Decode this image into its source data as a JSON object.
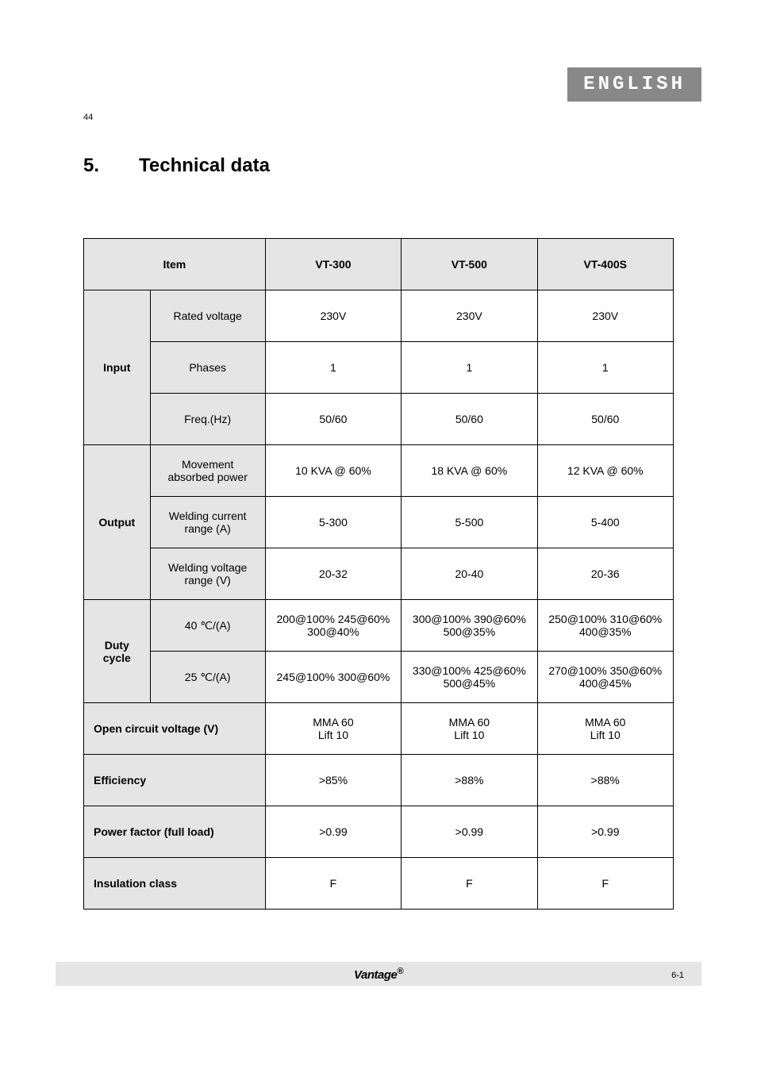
{
  "language_tab": "ENGLISH",
  "page_top": "44",
  "heading": {
    "number": "5.",
    "text": "Technical data"
  },
  "table": {
    "header": [
      "",
      "Item",
      "VT-300",
      "VT-500",
      "VT-400S"
    ],
    "rows": [
      {
        "group": "Input",
        "sub_rows": [
          {
            "sub": "Rated voltage",
            "c1": "230V",
            "c2": "230V",
            "c3": "230V"
          },
          {
            "sub": "Phases",
            "c1": "1",
            "c2": "1",
            "c3": "1"
          },
          {
            "sub": "Freq.(Hz)",
            "c1": "50/60",
            "c2": "50/60",
            "c3": "50/60"
          }
        ]
      },
      {
        "group": "Output",
        "sub_rows": [
          {
            "sub": "Movement absorbed power",
            "c1": "10 KVA @ 60%",
            "c2": "18 KVA @ 60%",
            "c3": "12 KVA @ 60%"
          },
          {
            "sub": "Welding current range (A)",
            "c1": "5-300",
            "c2": "5-500",
            "c3": "5-400"
          },
          {
            "sub": "Welding voltage range (V)",
            "c1": "20-32",
            "c2": "20-40",
            "c3": "20-36"
          }
        ]
      },
      {
        "group": "Duty cycle",
        "sub_rows": [
          {
            "sub": "40 ℃/(A)",
            "c1": "200@100% 245@60% 300@40%",
            "c2": "300@100% 390@60% 500@35%",
            "c3": "250@100% 310@60% 400@35%"
          },
          {
            "sub": "25 ℃/(A)",
            "c1": "245@100% 300@60%",
            "c2": "330@100% 425@60% 500@45%",
            "c3": "270@100% 350@60% 400@45%"
          }
        ]
      },
      {
        "group_span": "Open circuit voltage (V)",
        "c1": "MMA 60\nLift  10",
        "c2": "MMA 60\nLift  10",
        "c3": "MMA 60\nLift  10"
      },
      {
        "group_span": "Efficiency",
        "c1": ">85%",
        "c2": ">88%",
        "c3": ">88%"
      },
      {
        "group_span": "Power factor (full load)",
        "c1": ">0.99",
        "c2": ">0.99",
        "c3": ">0.99"
      },
      {
        "group_span": "Insulation class",
        "c1": "F",
        "c2": "F",
        "c3": "F"
      }
    ]
  },
  "footer_logo": "Vantage",
  "page_number_right": "6-1"
}
